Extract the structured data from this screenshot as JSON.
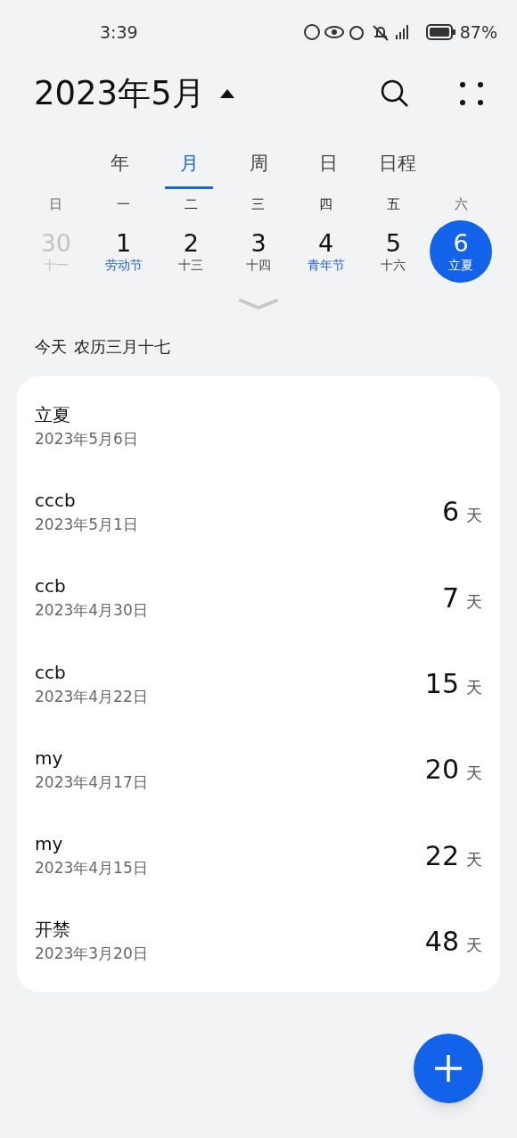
{
  "status_bar": {
    "time": "3:39",
    "battery": "87%"
  },
  "header": {
    "title": "2023年5月"
  },
  "tabs": [
    {
      "label": "年",
      "selected": false
    },
    {
      "label": "月",
      "selected": true
    },
    {
      "label": "周",
      "selected": false
    },
    {
      "label": "日",
      "selected": false
    },
    {
      "label": "日程",
      "selected": false
    }
  ],
  "weekdays": [
    "日",
    "一",
    "二",
    "三",
    "四",
    "五",
    "六"
  ],
  "days": [
    {
      "number": "30",
      "sub": "十一",
      "kind": "other",
      "selected": false
    },
    {
      "number": "1",
      "sub": "劳动节",
      "kind": "holiday",
      "selected": false
    },
    {
      "number": "2",
      "sub": "十三",
      "kind": "normal",
      "selected": false
    },
    {
      "number": "3",
      "sub": "十四",
      "kind": "normal",
      "selected": false
    },
    {
      "number": "4",
      "sub": "青年节",
      "kind": "holiday",
      "selected": false
    },
    {
      "number": "5",
      "sub": "十六",
      "kind": "normal",
      "selected": false
    },
    {
      "number": "6",
      "sub": "立夏",
      "kind": "normal",
      "selected": true
    }
  ],
  "today": {
    "label": "今天",
    "lunar": "农历三月十七"
  },
  "events": [
    {
      "title": "立夏",
      "date": "2023年5月6日"
    },
    {
      "title": "cccb",
      "date": "2023年5月1日",
      "count": "6",
      "unit": "天"
    },
    {
      "title": "ccb",
      "date": "2023年4月30日",
      "count": "7",
      "unit": "天"
    },
    {
      "title": "ccb",
      "date": "2023年4月22日",
      "count": "15",
      "unit": "天"
    },
    {
      "title": "my",
      "date": "2023年4月17日",
      "count": "20",
      "unit": "天"
    },
    {
      "title": "my",
      "date": "2023年4月15日",
      "count": "22",
      "unit": "天"
    },
    {
      "title": "开禁",
      "date": "2023年3月20日",
      "count": "48",
      "unit": "天"
    }
  ]
}
